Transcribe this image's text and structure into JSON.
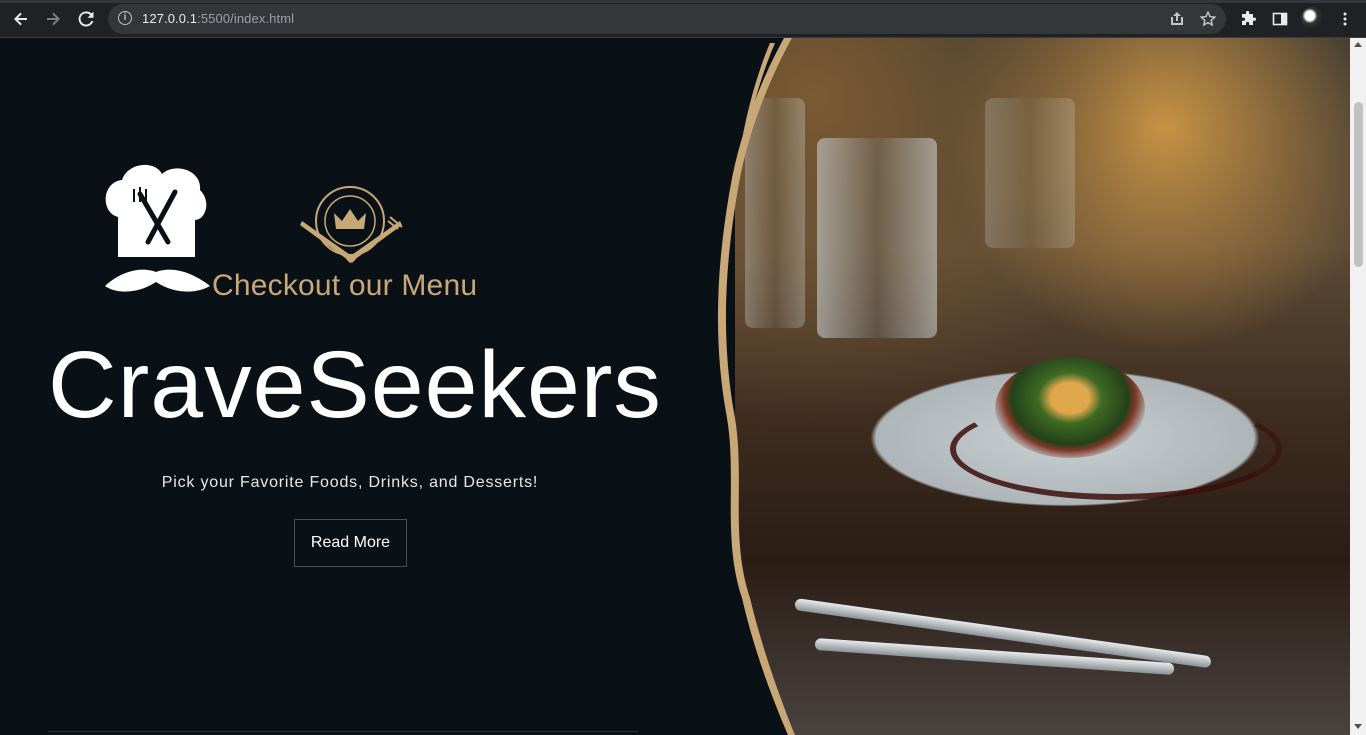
{
  "browser": {
    "url_host": "127.0.0.1",
    "url_rest": ":5500/index.html",
    "icons": {
      "back": "arrow-left-icon",
      "forward": "arrow-right-icon",
      "reload": "reload-icon",
      "site_info": "info-icon",
      "share": "share-icon",
      "bookmark": "star-icon",
      "extensions": "puzzle-icon",
      "side_panel": "side-panel-icon",
      "menu": "kebab-menu-icon"
    }
  },
  "hero": {
    "menu_label": "Checkout our Menu",
    "brand_name": "CraveSeekers",
    "tagline": "Pick your Favorite Foods, Drinks, and Desserts!",
    "cta_label": "Read More",
    "logos": [
      "chef-hat-mustache-icon",
      "crown-cutlery-icon"
    ]
  },
  "colors": {
    "background": "#0a1116",
    "accent_gold": "#c9a877",
    "text_white": "#ffffff"
  }
}
